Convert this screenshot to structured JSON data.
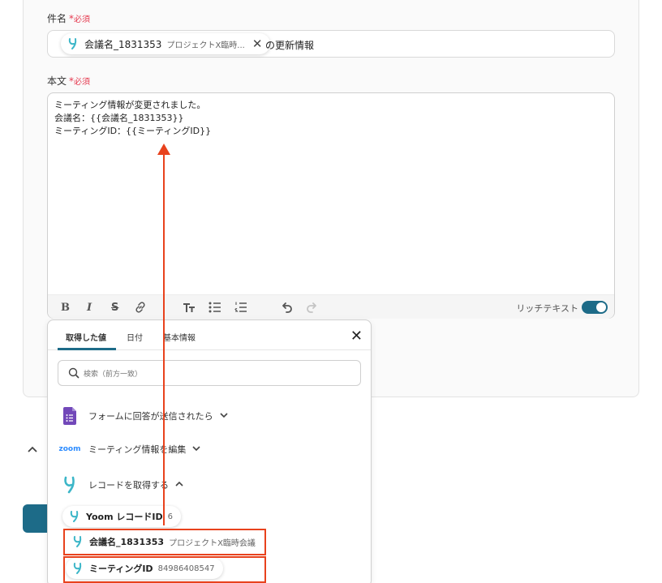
{
  "subject": {
    "label": "件名",
    "required_star": "*",
    "required_text": "必須",
    "chip_main": "会議名_1831353",
    "chip_sub": "プロジェクトX臨時...",
    "suffix": "の更新情報"
  },
  "body": {
    "label": "本文",
    "required_star": "*",
    "required_text": "必須",
    "lines": [
      "ミーティング情報が変更されました。",
      "会議名：{{会議名_1831353}}",
      "ミーティングID：{{ミーティングID}}"
    ],
    "rich_text_label": "リッチテキスト",
    "rich_text_on": true
  },
  "toolbar": {
    "icons": [
      "bold-icon",
      "italic-icon",
      "strikethrough-icon",
      "link-icon",
      "text-size-icon",
      "bullet-list-icon",
      "numbered-list-icon",
      "undo-icon",
      "redo-icon"
    ]
  },
  "collapse": {
    "icon": "chevron-up-icon"
  },
  "panel": {
    "tabs": [
      "取得した値",
      "日付",
      "基本情報"
    ],
    "active_tab": 0,
    "search_placeholder": "検索（前方一致）",
    "groups": [
      {
        "icon": "google-forms-icon",
        "label": "フォームに回答が送信されたら",
        "expanded": false
      },
      {
        "icon": "zoom-logo-icon",
        "icon_text": "zoom",
        "label": "ミーティング情報を編集",
        "expanded": false
      },
      {
        "icon": "yoom-logo-icon",
        "label": "レコードを取得する",
        "expanded": true
      }
    ],
    "items": [
      {
        "label": "Yoom レコードID",
        "value": "6"
      },
      {
        "label": "会議名_1831353",
        "value": "プロジェクトX臨時会議"
      },
      {
        "label": "ミーティングID",
        "value": "84986408547"
      }
    ]
  },
  "colors": {
    "accent": "#1d6b88",
    "highlight": "#e8421d",
    "required": "#e5394f"
  }
}
